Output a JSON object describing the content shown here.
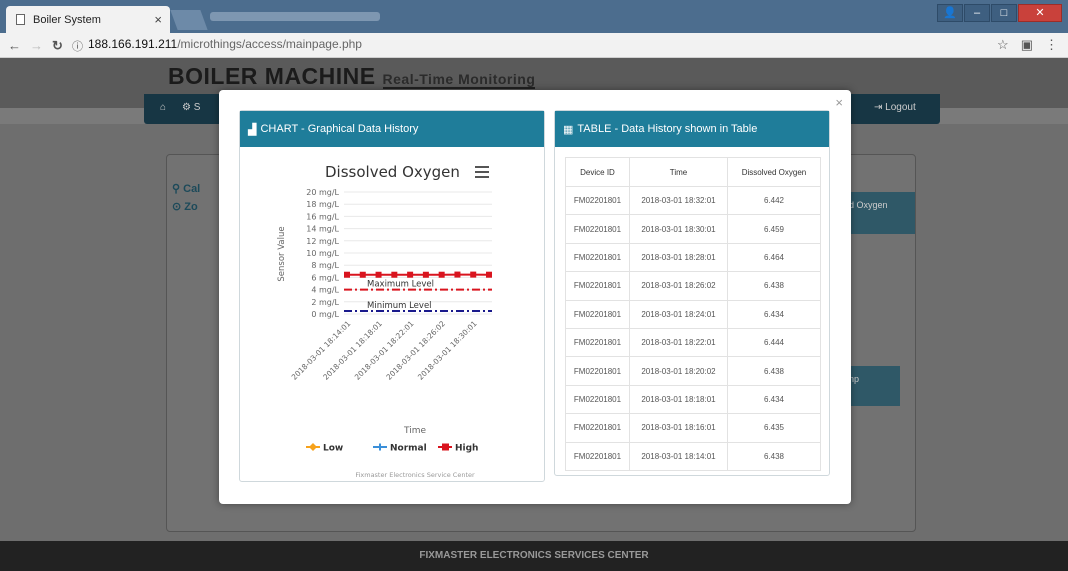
{
  "browser": {
    "tab_title": "Boiler System",
    "url_host": "188.166.191.211",
    "url_path": "/microthings/access/mainpage.php"
  },
  "page": {
    "brand": "BOILER MACHINE",
    "brand_sub": "Real-Time Monitoring",
    "logout": "Logout",
    "side_link_1": "Cal",
    "side_link_2": "Zo",
    "tile_1": "d Oxygen",
    "tile_2": "np",
    "footer": "FIXMASTER ELECTRONICS SERVICES CENTER"
  },
  "modal": {
    "close": "×",
    "chart_panel_title": "CHART - Graphical Data History",
    "table_panel_title": "TABLE - Data History shown in Table"
  },
  "chart_data": {
    "type": "line",
    "title": "Dissolved Oxygen",
    "ylabel": "Sensor Value",
    "xlabel": "Time",
    "ylim": [
      0,
      20
    ],
    "y_ticks": [
      "20 mg/L",
      "18 mg/L",
      "16 mg/L",
      "14 mg/L",
      "12 mg/L",
      "10 mg/L",
      "8 mg/L",
      "6 mg/L",
      "4 mg/L",
      "2 mg/L",
      "0 mg/L"
    ],
    "categories": [
      "2018-03-01 18:14:01",
      "2018-03-01 18:16:01",
      "2018-03-01 18:18:01",
      "2018-03-01 18:20:02",
      "2018-03-01 18:22:01",
      "2018-03-01 18:24:01",
      "2018-03-01 18:26:02",
      "2018-03-01 18:28:01",
      "2018-03-01 18:30:01",
      "2018-03-01 18:32:01"
    ],
    "x_tick_labels": [
      "2018-03-01 18:14:01",
      "2018-03-01 18:18:01",
      "2018-03-01 18:22:01",
      "2018-03-01 18:26:02",
      "2018-03-01 18:30:01"
    ],
    "series": [
      {
        "name": "Low",
        "color": "#f7a21b",
        "values": []
      },
      {
        "name": "Normal",
        "color": "#3a8fd9",
        "values": []
      },
      {
        "name": "High",
        "color": "#d9141e",
        "values": [
          6.438,
          6.435,
          6.434,
          6.438,
          6.444,
          6.434,
          6.438,
          6.464,
          6.459,
          6.442
        ]
      }
    ],
    "plot_lines": [
      {
        "label": "Maximum Level",
        "value": 4,
        "color": "#d9141e"
      },
      {
        "label": "Minimum Level",
        "value": 0.5,
        "color": "#1a1a8c"
      }
    ],
    "credits": "Fixmaster Electronics Service Center"
  },
  "table": {
    "headers": [
      "Device ID",
      "Time",
      "Dissolved Oxygen"
    ],
    "rows": [
      [
        "FM02201801",
        "2018-03-01 18:32:01",
        "6.442"
      ],
      [
        "FM02201801",
        "2018-03-01 18:30:01",
        "6.459"
      ],
      [
        "FM02201801",
        "2018-03-01 18:28:01",
        "6.464"
      ],
      [
        "FM02201801",
        "2018-03-01 18:26:02",
        "6.438"
      ],
      [
        "FM02201801",
        "2018-03-01 18:24:01",
        "6.434"
      ],
      [
        "FM02201801",
        "2018-03-01 18:22:01",
        "6.444"
      ],
      [
        "FM02201801",
        "2018-03-01 18:20:02",
        "6.438"
      ],
      [
        "FM02201801",
        "2018-03-01 18:18:01",
        "6.434"
      ],
      [
        "FM02201801",
        "2018-03-01 18:16:01",
        "6.435"
      ],
      [
        "FM02201801",
        "2018-03-01 18:14:01",
        "6.438"
      ]
    ]
  }
}
